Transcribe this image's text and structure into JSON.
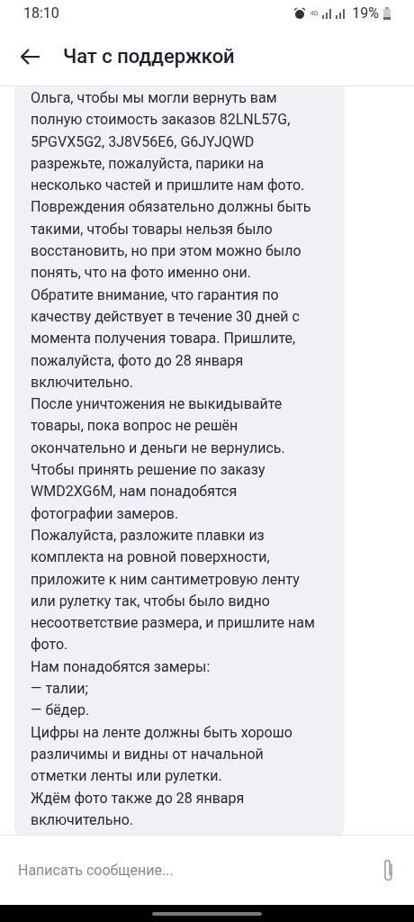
{
  "status_bar": {
    "time": "18:10",
    "network": "4G",
    "battery": "19%"
  },
  "header": {
    "title": "Чат с поддержкой"
  },
  "message": {
    "lines": [
      "Ольга, чтобы мы могли вернуть вам",
      "полную стоимость заказов 82LNL57G,",
      "5PGVX5G2, 3J8V56E6, G6JYJQWD",
      "разрежьте, пожалуйста, парики на",
      "несколько частей и пришлите нам фото.",
      "Повреждения обязательно должны быть",
      "такими, чтобы товары нельзя было",
      "восстановить, но при этом можно было",
      "понять, что на фото именно они.",
      "Обратите внимание, что гарантия по",
      "качеству действует в течение 30 дней с",
      "момента получения товара. Пришлите,",
      "пожалуйста, фото до 28 января",
      "включительно.",
      "После уничтожения не выкидывайте",
      "товары, пока вопрос не решён",
      "окончательно и деньги не вернулись.",
      "Чтобы принять решение по заказу",
      "WMD2XG6M, нам понадобятся",
      "фотографии замеров.",
      "Пожалуйста, разложите плавки из",
      "комплекта на ровной поверхности,",
      "приложите к ним сантиметровую ленту",
      "или рулетку так, чтобы было видно",
      "несоответствие размера, и пришлите нам",
      "фото.",
      "Нам понадобятся замеры:",
      "— талии;",
      "— бёдер.",
      "Цифры на ленте должны быть хорошо",
      "различимы и видны от начальной",
      "отметки ленты или рулетки.",
      "Ждём фото также до 28 января",
      "включительно."
    ]
  },
  "composer": {
    "placeholder": "Написать сообщение..."
  }
}
